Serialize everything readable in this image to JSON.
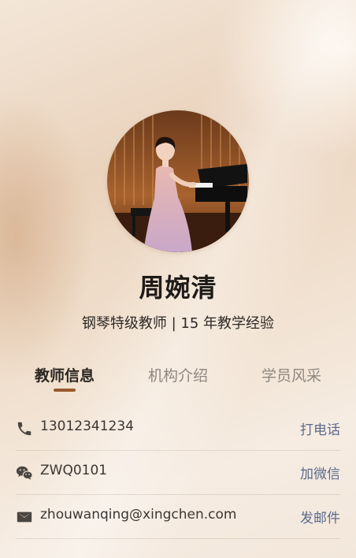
{
  "profile": {
    "name": "周婉清",
    "subtitle": "钢琴特级教师 | 15 年教学经验",
    "avatar_icon": "teacher-portrait-at-piano"
  },
  "tabs": [
    {
      "label": "教师信息",
      "active": true
    },
    {
      "label": "机构介绍",
      "active": false
    },
    {
      "label": "学员风采",
      "active": false
    }
  ],
  "contacts": [
    {
      "icon": "phone-icon",
      "value": "13012341234",
      "action": "打电话"
    },
    {
      "icon": "wechat-icon",
      "value": "ZWQ0101",
      "action": "加微信"
    },
    {
      "icon": "mail-icon",
      "value": "zhouwanqing@xingchen.com",
      "action": "发邮件"
    }
  ],
  "colors": {
    "accent": "#9a5a2d",
    "action_link": "#5b6b8c",
    "background": "#f0dfcd"
  }
}
